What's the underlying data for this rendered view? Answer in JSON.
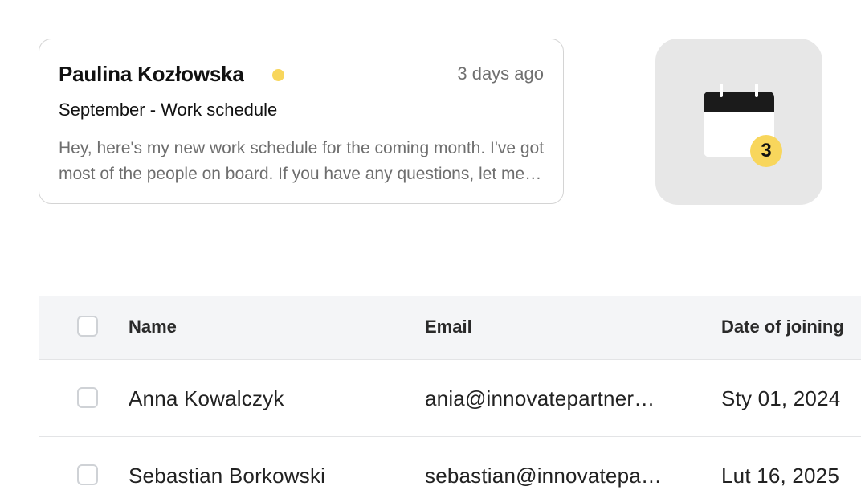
{
  "message": {
    "sender": "Paulina Kozłowska",
    "time": "3 days ago",
    "subject": "September - Work schedule",
    "preview": "Hey, here's my new work schedule for the coming month. I've got most of the people on board. If you have any questions, let me know.",
    "status_color": "#f8d65c"
  },
  "calendar": {
    "icon": "calendar-icon",
    "badge_count": "3",
    "badge_color": "#f8d65c"
  },
  "table": {
    "headers": {
      "name": "Name",
      "email": "Email",
      "date": "Date of joining"
    },
    "rows": [
      {
        "name": "Anna Kowalczyk",
        "email": "ania@innovatepartner…",
        "date": "Sty 01, 2024"
      },
      {
        "name": "Sebastian Borkowski",
        "email": "sebastian@innovatepa…",
        "date": "Lut 16, 2025"
      }
    ]
  }
}
